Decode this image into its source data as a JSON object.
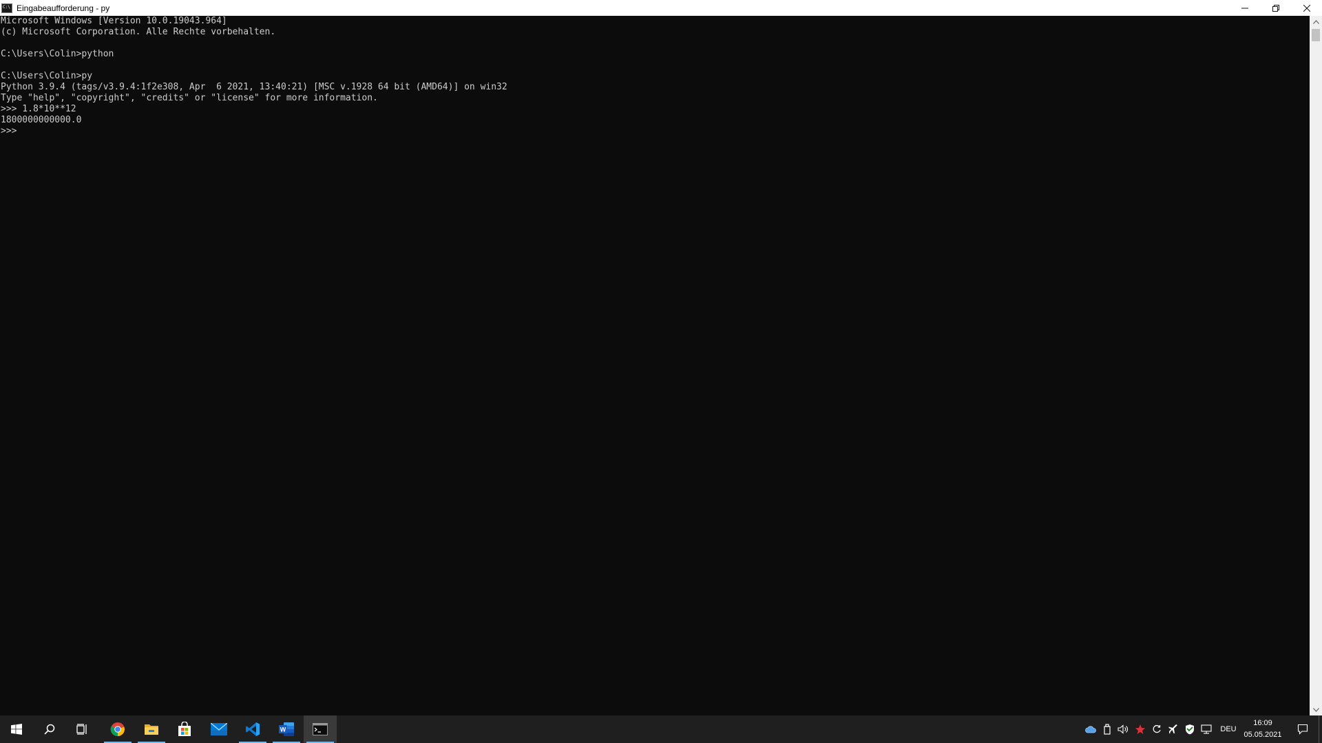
{
  "window": {
    "title": "Eingabeaufforderung - py"
  },
  "console": {
    "lines": [
      "Microsoft Windows [Version 10.0.19043.964]",
      "(c) Microsoft Corporation. Alle Rechte vorbehalten.",
      "",
      "C:\\Users\\Colin>python",
      "",
      "C:\\Users\\Colin>py",
      "Python 3.9.4 (tags/v3.9.4:1f2e308, Apr  6 2021, 13:40:21) [MSC v.1928 64 bit (AMD64)] on win32",
      "Type \"help\", \"copyright\", \"credits\" or \"license\" for more information.",
      ">>> 1.8*10**12",
      "1800000000000.0",
      ">>> "
    ]
  },
  "taskbar": {
    "apps": [
      {
        "icon": "start-windows-icon"
      },
      {
        "icon": "search-icon"
      },
      {
        "icon": "task-view-icon"
      },
      {
        "icon": "chrome-icon",
        "running": true
      },
      {
        "icon": "file-explorer-icon",
        "running": true
      },
      {
        "icon": "store-icon"
      },
      {
        "icon": "mail-icon"
      },
      {
        "icon": "vscode-icon",
        "running": true
      },
      {
        "icon": "word-icon",
        "running": true
      },
      {
        "icon": "command-prompt-icon",
        "running": true,
        "active": true
      }
    ],
    "tray": {
      "language": "DEU",
      "time": "16:09",
      "date": "05.05.2021"
    }
  },
  "colors": {
    "console_bg": "#0c0c0c",
    "console_fg": "#cccccc",
    "taskbar_bg": "#1f1f1f",
    "accent": "#76b9ed"
  }
}
